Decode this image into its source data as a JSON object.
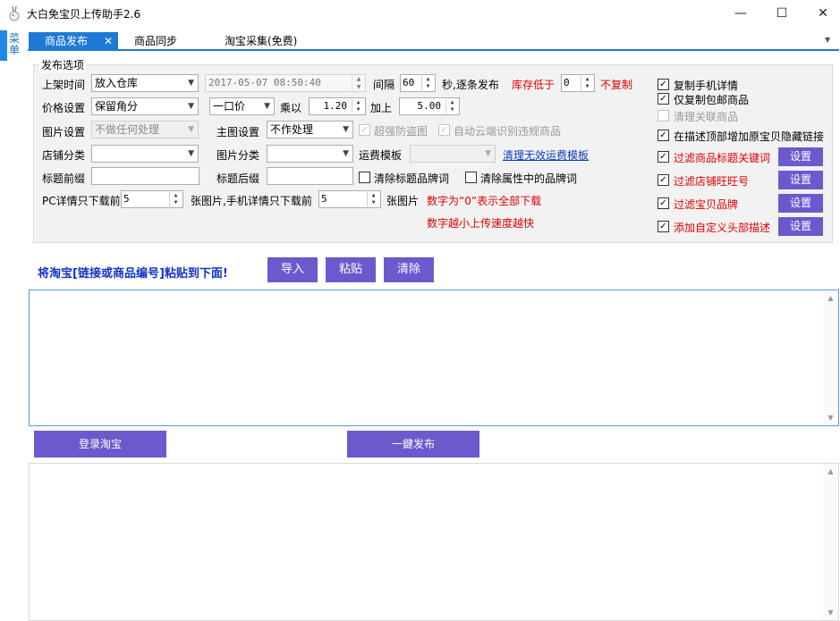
{
  "window": {
    "title": "大白免宝贝上传助手2.6",
    "minimize": "—",
    "maximize": "☐",
    "close": "✕"
  },
  "rail": {
    "menu_label": "菜单"
  },
  "tabs": [
    {
      "label": "商品发布",
      "close": "✕"
    },
    {
      "label": "商品同步"
    },
    {
      "label": "淘宝采集(免费)"
    }
  ],
  "tab_overflow": "▼",
  "options": {
    "group_title": "发布选项",
    "row1": {
      "label": "上架时间",
      "mode": "放入仓库",
      "datetime": "2017-05-07 08:50:40",
      "interval_label": "间隔",
      "interval_value": "60",
      "interval_suffix": "秒,逐条发布",
      "stock_label": "库存低于",
      "stock_value": "0",
      "stock_suffix": "不复制"
    },
    "row2": {
      "label": "价格设置",
      "rounding": "保留角分",
      "price_type": "一口价",
      "multiply_label": "乘以",
      "multiply_value": "1.20",
      "add_label": "加上",
      "add_value": "5.00"
    },
    "row3": {
      "label": "图片设置",
      "image_mode": "不做任何处理",
      "main_label": "主图设置",
      "main_mode": "不作处理",
      "anti_theft": "超强防盗图",
      "cloud_check": "自动云端识别违规商品"
    },
    "row4": {
      "shop_cat_label": "店铺分类",
      "img_cat_label": "图片分类",
      "shipping_label": "运费模板",
      "clean_shipping": "清理无效运费模板"
    },
    "row5": {
      "prefix_label": "标题前缀",
      "suffix_label": "标题后缀",
      "clear_title_brand": "清除标题品牌词",
      "clear_attr_brand": "清除属性中的品牌词"
    },
    "row6": {
      "pc_label": "PC详情只下载前",
      "pc_value": "5",
      "pc_suffix": "张图片,手机详情只下载前",
      "mobile_value": "5",
      "mobile_suffix": "张图片",
      "note1": "数字为“0”表示全部下载",
      "note2": "数字越小上传速度越快"
    },
    "right": {
      "copy_mobile": "复制手机详情",
      "free_ship_only": "仅复制包邮商品",
      "clean_related": "清理关联商品",
      "hidden_link": "在描述顶部增加原宝贝隐藏链接",
      "filter_title_kw": "过滤商品标题关键词",
      "filter_shop_ww": "过滤店铺旺旺号",
      "filter_brand": "过滤宝贝品牌",
      "custom_header": "添加自定义头部描述",
      "set": "设置"
    }
  },
  "paste": {
    "hint": "将淘宝[链接或商品编号]粘贴到下面!",
    "import": "导入",
    "paste": "粘贴",
    "clear": "清除"
  },
  "actions": {
    "login": "登录淘宝",
    "publish": "一鍵发布"
  },
  "colors": {
    "accent": "#1f7ad6",
    "button": "#6a5acd",
    "warning": "#e00000"
  }
}
